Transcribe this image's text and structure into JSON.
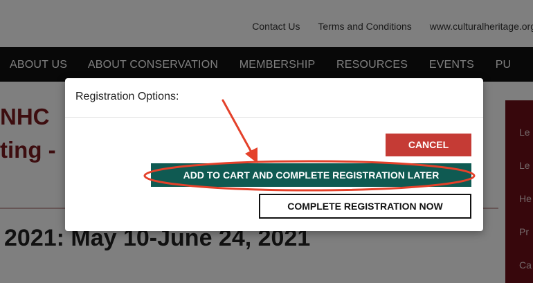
{
  "header": {
    "links": [
      {
        "label": "Contact Us"
      },
      {
        "label": "Terms and Conditions"
      },
      {
        "label": "www.culturalheritage.org"
      }
    ]
  },
  "nav": {
    "items": [
      {
        "label": "ABOUT US"
      },
      {
        "label": "ABOUT CONSERVATION"
      },
      {
        "label": "MEMBERSHIP"
      },
      {
        "label": "RESOURCES"
      },
      {
        "label": "EVENTS"
      },
      {
        "label": "PU"
      }
    ]
  },
  "background": {
    "title_line1": "NHC",
    "title_line2": "ting -",
    "date_heading": "2021: May 10-June 24, 2021",
    "sidebar_items": [
      {
        "label": "Le"
      },
      {
        "label": "Le"
      },
      {
        "label": "He"
      },
      {
        "label": "Pr"
      },
      {
        "label": "Ca"
      }
    ]
  },
  "modal": {
    "title": "Registration Options:",
    "buttons": {
      "cancel": "CANCEL",
      "add_to_cart": "ADD TO CART AND COMPLETE REGISTRATION LATER",
      "complete_now": "COMPLETE REGISTRATION NOW"
    }
  },
  "annotation": {
    "color": "#e4412a",
    "shape": "arrow-and-oval"
  },
  "colors": {
    "nav_bg": "#101010",
    "accent_maroon": "#7a1a1f",
    "cancel_red": "#c53b35",
    "cart_teal": "#0f5a52",
    "sidebar_maroon": "#6f0f18"
  }
}
